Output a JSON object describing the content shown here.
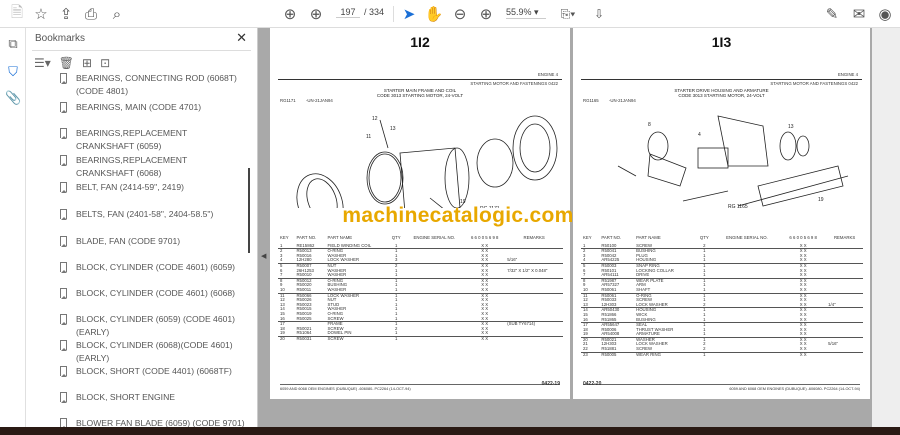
{
  "toolbar": {
    "page_current": "197",
    "page_total": "/ 334",
    "zoom": "55.9%"
  },
  "bookmarks": {
    "title": "Bookmarks",
    "items": [
      "BEARINGS, CONNECTING ROD (6068T) (CODE 4801)",
      "BEARINGS, MAIN (CODE 4701)",
      "BEARINGS,REPLACEMENT CRANKSHAFT (6059)",
      "BEARINGS,REPLACEMENT CRANKSHAFT (6068)",
      "BELT, FAN (2414-59\", 2419)",
      "BELTS, FAN (2401-58\", 2404-58.5\")",
      "BLADE, FAN (CODE 9701)",
      "BLOCK, CYLINDER (CODE 4601) (6059)",
      "BLOCK, CYLINDER (CODE 4601) (6068)",
      "BLOCK, CYLINDER (6059) (CODE 4601) (EARLY)",
      "BLOCK, CYLINDER (6068)(CODE 4601)(EARLY)",
      "BLOCK, SHORT (CODE 4401) (6068TF)",
      "BLOCK, SHORT ENGINE",
      "BLOWER FAN BLADE (6059) (CODE 9701)"
    ]
  },
  "watermark": "machinecatalogic.com",
  "pages": [
    {
      "page_label": "1I2",
      "section": "ENGINE  4",
      "section_sub": "STARTING MOTOR AND FASTENINGS  0422",
      "title_line1": "STARTER MAIN FRAME AND COIL",
      "title_line2": "CODE 3013     STARTING MOTOR, 24-VOLT",
      "ref": "RG1171",
      "ref2": "-UN-21JAN94",
      "fig_no": "RG 1171",
      "headers": [
        "KEY",
        "PART NO.",
        "PART NAME",
        "QTY",
        "ENGINE SERIAL NO.",
        "6 6 0 0 5 6 9 8",
        "REMARKS"
      ],
      "rows": [
        [
          "1",
          "RE15862",
          "FIELD WINDING COIL",
          "1",
          "",
          "X X",
          ""
        ],
        [
          "2",
          "R50013",
          "O-RING",
          "1",
          "",
          "X X",
          ""
        ],
        [
          "3",
          "R50016",
          "WASHER",
          "1",
          "",
          "X X",
          ""
        ],
        [
          "4",
          "12H280",
          "LOCK WASHER",
          "3",
          "",
          "X X",
          "5/16\""
        ],
        [
          "5",
          "R50007",
          "NUT",
          "2",
          "",
          "X X",
          ""
        ],
        [
          "6",
          "26H1253",
          "WASHER",
          "1",
          "",
          "X X",
          "7/32\" X 1/2\" X 0.048\""
        ],
        [
          "7",
          "R50010",
          "WASHER",
          "1",
          "",
          "X X",
          ""
        ],
        [
          "8",
          "R50012",
          "O-RING",
          "1",
          "",
          "X X",
          ""
        ],
        [
          "9",
          "R50020",
          "BUSHING",
          "1",
          "",
          "X X",
          ""
        ],
        [
          "10",
          "R50011",
          "WASHER",
          "1",
          "",
          "X X",
          ""
        ],
        [
          "11",
          "R50066",
          "LOCK WASHER",
          "1",
          "",
          "X X",
          ""
        ],
        [
          "12",
          "R50026",
          "NUT",
          "1",
          "",
          "X X",
          ""
        ],
        [
          "13",
          "R50023",
          "STUD",
          "1",
          "",
          "X X",
          ""
        ],
        [
          "14",
          "R50015",
          "WASHER",
          "1",
          "",
          "X X",
          ""
        ],
        [
          "15",
          "R50019",
          "O-RING",
          "1",
          "",
          "X X",
          ""
        ],
        [
          "16",
          "R50025",
          "SCREW",
          "1",
          "",
          "X X",
          ""
        ],
        [
          "17",
          "",
          "FRAME",
          "1",
          "",
          "X X",
          "(SUB TY6714)"
        ],
        [
          "18",
          "R50021",
          "SCREW",
          "2",
          "",
          "X X",
          ""
        ],
        [
          "19",
          "R51064",
          "DOWEL PIN",
          "1",
          "",
          "X X",
          ""
        ],
        [
          "20",
          "R50031",
          "SCREW",
          "1",
          "",
          "X X",
          ""
        ]
      ],
      "footer_left": "6059 AND 6068 OEM ENGINES (DUBUQUE)   -606080-   PC2264   (14-OCT-94)",
      "footer_num": "0422-19"
    },
    {
      "page_label": "1I3",
      "section": "ENGINE  4",
      "section_sub": "STARTING MOTOR AND FASTENINGS  0422",
      "title_line1": "STARTER DRIVE HOUSING AND ARMATURE",
      "title_line2": "CODE 3013     STARTING MOTOR, 24-VOLT",
      "ref": "RG1165",
      "ref2": "-UN-21JAN94",
      "fig_no": "RG 1165",
      "headers": [
        "KEY",
        "PART NO.",
        "PART NAME",
        "QTY",
        "ENGINE SERIAL NO.",
        "6 6 0 0 5 6 9 8",
        "REMARKS"
      ],
      "rows": [
        [
          "1",
          "R50100",
          "SCREW",
          "2",
          "",
          "X X",
          ""
        ],
        [
          "2",
          "R50041",
          "BUSHING",
          "1",
          "",
          "X X",
          ""
        ],
        [
          "3",
          "R50042",
          "PLUG",
          "1",
          "",
          "X X",
          ""
        ],
        [
          "4",
          "AR54225",
          "HOUSING",
          "1",
          "",
          "X X",
          ""
        ],
        [
          "5",
          "R50003",
          "SNAP RING",
          "1",
          "",
          "X X",
          ""
        ],
        [
          "6",
          "R50101",
          "LOCKING COLLAR",
          "1",
          "",
          "X X",
          ""
        ],
        [
          "7",
          "AR54111",
          "DRIVE",
          "1",
          "",
          "X X",
          ""
        ],
        [
          "8",
          "R51987",
          "WEAR PLATE",
          "1",
          "",
          "X X",
          ""
        ],
        [
          "9",
          "AR57327",
          "ARM",
          "1",
          "",
          "X X",
          ""
        ],
        [
          "10",
          "R50061",
          "SHAFT",
          "1",
          "",
          "X X",
          ""
        ],
        [
          "11",
          "R50061",
          "O-RING",
          "1",
          "",
          "X X",
          ""
        ],
        [
          "12",
          "R50033",
          "SCREW",
          "1",
          "",
          "X X",
          ""
        ],
        [
          "13",
          "12H303",
          "LOCK WASHER",
          "2",
          "",
          "X X",
          "1/4\""
        ],
        [
          "14",
          "AR50430",
          "HOUSING",
          "1",
          "",
          "X X",
          ""
        ],
        [
          "15",
          "R51866",
          "WICK",
          "1",
          "",
          "X X",
          ""
        ],
        [
          "16",
          "R51865",
          "BUSHING",
          "1",
          "",
          "X X",
          ""
        ],
        [
          "17",
          "AR55647",
          "SEAL",
          "1",
          "",
          "X X",
          ""
        ],
        [
          "18",
          "R50006",
          "THRUST WASHER",
          "1",
          "",
          "X X",
          ""
        ],
        [
          "19",
          "AR54008",
          "ARMATURE",
          "1",
          "",
          "X X",
          ""
        ],
        [
          "20",
          "R50021",
          "WASHER",
          "1",
          "",
          "X X",
          ""
        ],
        [
          "21",
          "12H303",
          "LOCK WASHER",
          "2",
          "",
          "X X",
          "5/16\""
        ],
        [
          "22",
          "R51881",
          "SCREW",
          "2",
          "",
          "X X",
          ""
        ],
        [
          "23",
          "R50005",
          "WEAR RING",
          "1",
          "",
          "X X",
          ""
        ]
      ],
      "footer_left": "6059 AND 6068 OEM ENGINES (DUBUQUE)   -606080-   PC2264   (14-OCT-94)",
      "footer_num": "0422-20"
    }
  ]
}
